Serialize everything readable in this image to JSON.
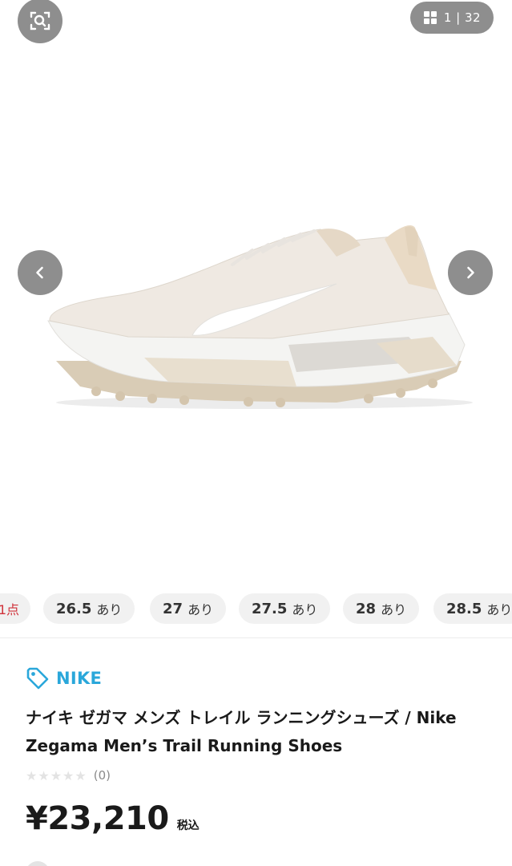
{
  "gallery": {
    "counter_text": "1 | 32",
    "icons": {
      "lens": "image-search-icon",
      "grid": "grid-icon",
      "prev": "chevron-left-icon",
      "next": "chevron-right-icon"
    },
    "sizes": [
      {
        "partial_label": "1点"
      },
      {
        "size": "26.5",
        "stock": "あり"
      },
      {
        "size": "27",
        "stock": "あり"
      },
      {
        "size": "27.5",
        "stock": "あり"
      },
      {
        "size": "28",
        "stock": "あり"
      },
      {
        "size": "28.5",
        "stock": "あり"
      }
    ]
  },
  "product": {
    "brand": "NIKE",
    "brand_icon": "tag-icon",
    "title": "ナイキ ゼガマ メンズ トレイル ランニングシューズ / Nike Zegama Men’s Trail Running Shoes",
    "rating": {
      "stars_filled": 0,
      "stars_total": 5,
      "count_text": "(0)"
    },
    "price": "¥23,210",
    "tax_label": "税込"
  },
  "colors": {
    "brand_accent": "#2aa7da",
    "partial_red": "#d0323a",
    "chip_bg": "#f1f1f1",
    "overlay_gray": "#6e6e6e"
  }
}
